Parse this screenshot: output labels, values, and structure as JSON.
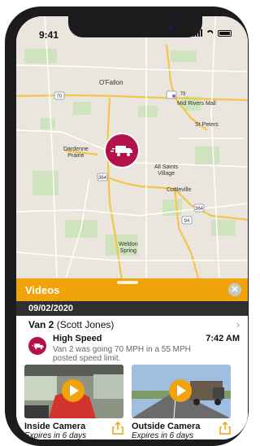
{
  "status_bar": {
    "time": "9:41"
  },
  "map": {
    "labels": {
      "ofallon": "O'Fallon",
      "hwy70": "70",
      "hwy79": "79",
      "mid_rivers_mall": "Mid Rivers Mall",
      "st_peters": "St Peters",
      "dardenne_prairie": "Dardenne\nPrairie",
      "all_saints_village": "All Saints\nVillage",
      "cottleville": "Cottleville",
      "hwy364a": "364",
      "hwy364b": "364",
      "hwy94": "94",
      "weldon_spring": "Weldon\nSpring"
    }
  },
  "sheet": {
    "title": "Videos",
    "date": "09/02/2020",
    "vehicle": "Van 2",
    "driver": "(Scott Jones)",
    "alert": {
      "title": "High Speed",
      "time": "7:42 AM",
      "description": "Van 2 was going 70 MPH in a 55 MPH posted speed limit."
    },
    "cameras": [
      {
        "name": "Inside Camera",
        "expires": "Expires in 6 days"
      },
      {
        "name": "Outside Camera",
        "expires": "Expires in 6 days"
      }
    ]
  },
  "colors": {
    "accent": "#f0a30a",
    "marker": "#b3124a",
    "band": "#2f2f2f"
  }
}
